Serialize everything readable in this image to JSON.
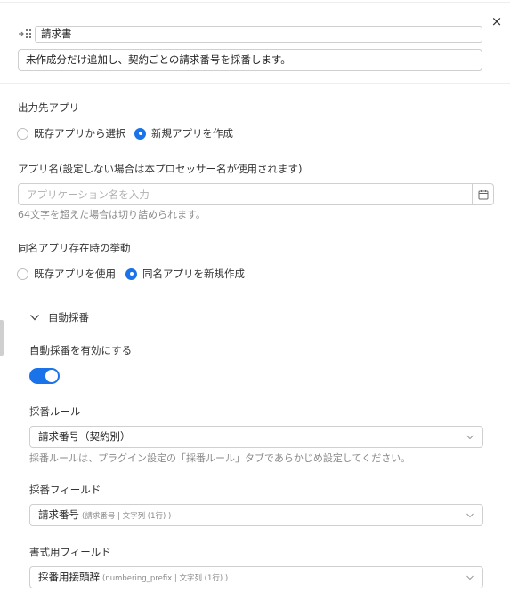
{
  "close_label": "×",
  "processor": {
    "title": "請求書",
    "description": "未作成分だけ追加し、契約ごとの請求番号を採番します。"
  },
  "output_app": {
    "label": "出力先アプリ",
    "options": [
      "既存アプリから選択",
      "新規アプリを作成"
    ],
    "selected": 1
  },
  "app_name": {
    "label": "アプリ名(設定しない場合は本プロセッサー名が使用されます)",
    "value": "",
    "placeholder": "アプリケーション名を入力",
    "hint": "64文字を超えた場合は切り詰められます。"
  },
  "same_name": {
    "label": "同名アプリ存在時の挙動",
    "options": [
      "既存アプリを使用",
      "同名アプリを新規作成"
    ],
    "selected": 1
  },
  "auto_numbering": {
    "section_title": "自動採番",
    "expanded": true,
    "enable_label": "自動採番を有効にする",
    "enabled": true,
    "rule_label": "採番ルール",
    "rule_value": "請求番号（契約別）",
    "rule_hint": "採番ルールは、プラグイン設定の「採番ルール」タブであらかじめ設定してください。",
    "field_label": "採番フィールド",
    "field_value": "請求番号",
    "field_sub": "(請求番号 | 文字列 (1行) )",
    "format_label": "書式用フィールド",
    "format_value": "採番用接頭辞",
    "format_sub": "(numbering_prefix | 文字列 (1行) )"
  },
  "colors": {
    "accent": "#1a73e8",
    "border": "#cfcfcf",
    "hint_text": "#8a8a8a"
  },
  "icons": [
    "drag-handle-icon",
    "close-icon",
    "calendar-icon",
    "chevron-down-icon",
    "select-arrow-icon"
  ]
}
